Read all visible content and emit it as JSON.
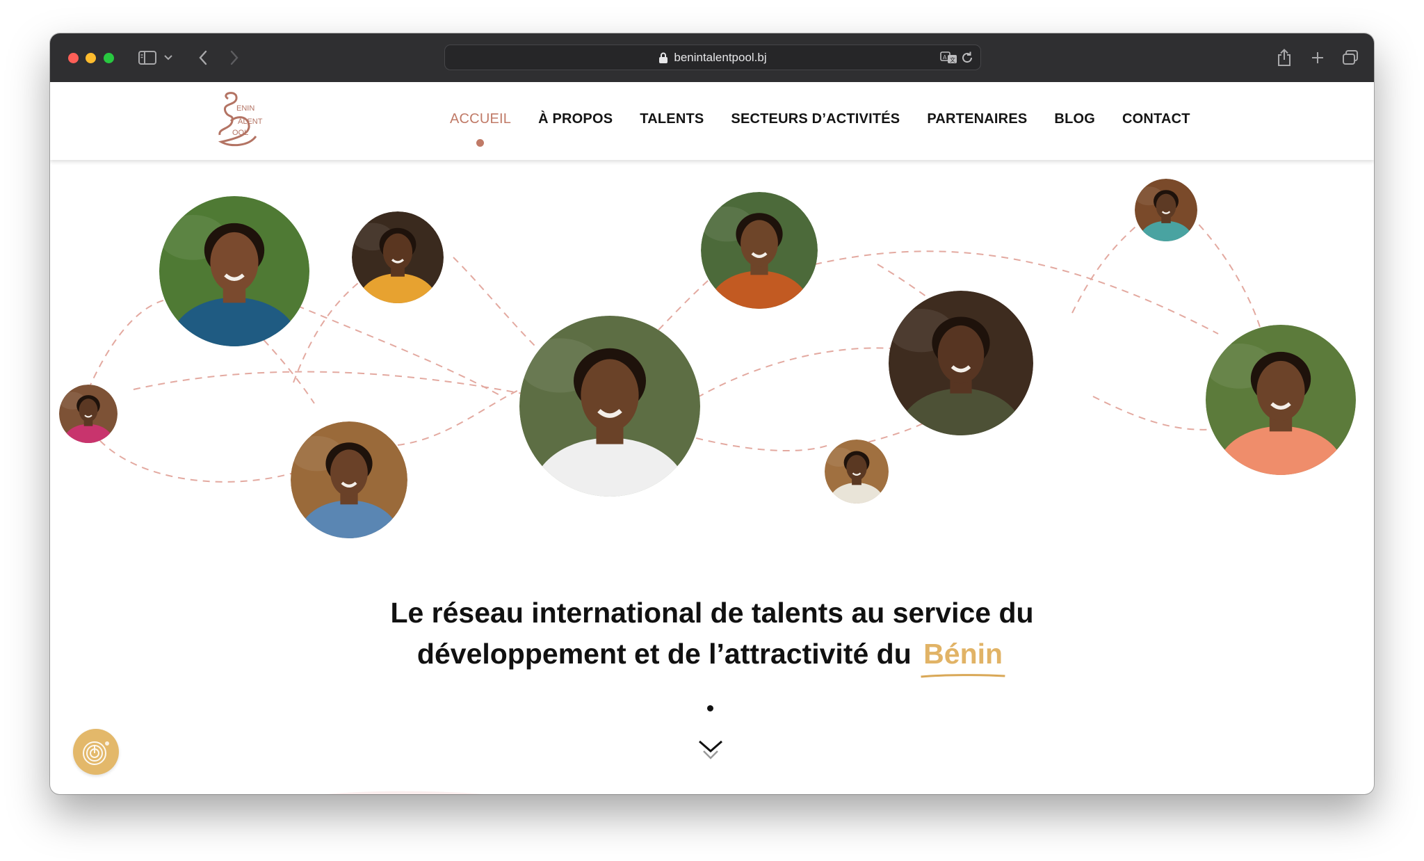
{
  "browser": {
    "url": "benintalentpool.bj",
    "icons": [
      "sidebar-icon",
      "chevron-down-icon",
      "back-icon",
      "forward-icon",
      "lock-icon",
      "translate-icon",
      "reload-icon",
      "share-icon",
      "new-tab-icon",
      "tab-overview-icon"
    ]
  },
  "site": {
    "logo_text": [
      "ENIN",
      "ALENT",
      "OOL"
    ],
    "nav": [
      {
        "label": "ACCUEIL",
        "active": true
      },
      {
        "label": "À PROPOS",
        "active": false
      },
      {
        "label": "TALENTS",
        "active": false
      },
      {
        "label": "SECTEURS D’ACTIVITÉS",
        "active": false
      },
      {
        "label": "PARTENAIRES",
        "active": false
      },
      {
        "label": "BLOG",
        "active": false
      },
      {
        "label": "CONTACT",
        "active": false
      }
    ]
  },
  "hero": {
    "headline_line1": "Le réseau international de talents au service du",
    "headline_line2": "développement et de l’attractivité du ",
    "headline_highlight": "Bénin",
    "portraits": [
      {
        "name": "portrait-woman-braids",
        "skin": "#7a4a2e",
        "clothes": "#1f5b82",
        "bg": "#4f7a34"
      },
      {
        "name": "portrait-man-yellow-shirt",
        "skin": "#5a3620",
        "clothes": "#e7a230",
        "bg": "#3a2a1e"
      },
      {
        "name": "portrait-woman-glasses-pattern",
        "skin": "#6e4529",
        "clothes": "#c25a22",
        "bg": "#4c6a3a"
      },
      {
        "name": "portrait-man-teal-shirt",
        "skin": "#5d3a24",
        "clothes": "#49a3a1",
        "bg": "#7a4a2a"
      },
      {
        "name": "portrait-man-pink-shirt",
        "skin": "#5b3823",
        "clothes": "#c8346d",
        "bg": "#7d5236"
      },
      {
        "name": "portrait-woman-center",
        "skin": "#6a4228",
        "clothes": "#efefef",
        "bg": "#5d6e44"
      },
      {
        "name": "portrait-man-olive-shirt",
        "skin": "#573522",
        "clothes": "#4d5136",
        "bg": "#3e2c1f"
      },
      {
        "name": "portrait-woman-denim",
        "skin": "#6a4128",
        "clothes": "#5a86b3",
        "bg": "#9a6a3a"
      },
      {
        "name": "portrait-man-white-shirt",
        "skin": "#5a3822",
        "clothes": "#e9e4d8",
        "bg": "#a07040"
      },
      {
        "name": "portrait-woman-coral-top",
        "skin": "#6c4329",
        "clothes": "#ef8d6b",
        "bg": "#5c7b3b"
      }
    ]
  },
  "colors": {
    "accent": "#c07a67",
    "gold": "#e1b366",
    "dash": "#e3a9a0",
    "toolbar": "#2f2f31"
  }
}
